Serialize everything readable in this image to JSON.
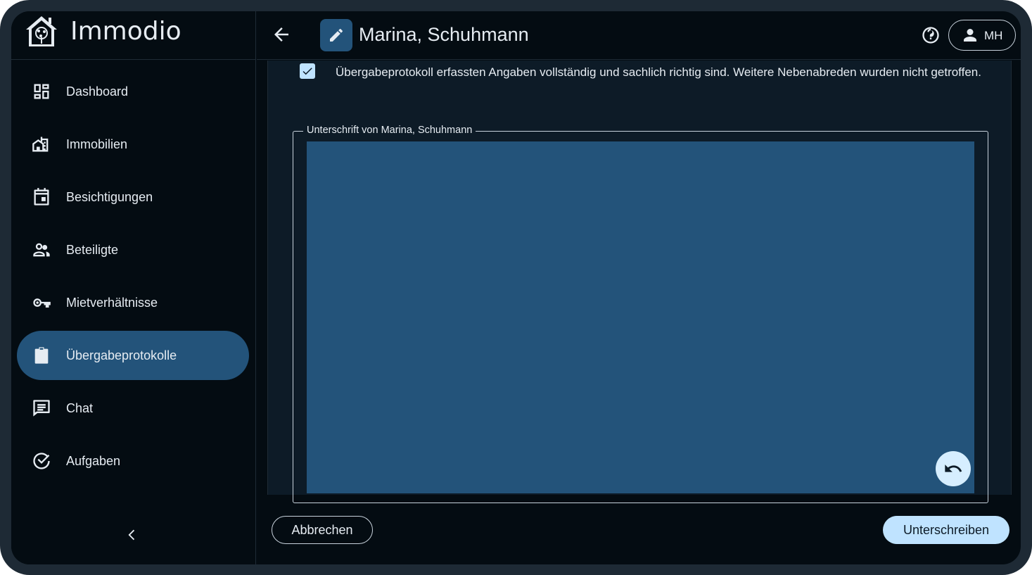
{
  "app": {
    "name": "Immodio",
    "logo_icon": "house-tree-icon"
  },
  "sidebar": {
    "items": [
      {
        "label": "Dashboard",
        "icon": "dashboard-icon",
        "active": false
      },
      {
        "label": "Immobilien",
        "icon": "buildings-icon",
        "active": false
      },
      {
        "label": "Besichtigungen",
        "icon": "calendar-icon",
        "active": false
      },
      {
        "label": "Beteiligte",
        "icon": "people-icon",
        "active": false
      },
      {
        "label": "Mietverhältnisse",
        "icon": "key-icon",
        "active": false
      },
      {
        "label": "Übergabeprotokolle",
        "icon": "clipboard-check-icon",
        "active": true
      },
      {
        "label": "Chat",
        "icon": "chat-icon",
        "active": false
      },
      {
        "label": "Aufgaben",
        "icon": "check-circle-icon",
        "active": false
      }
    ],
    "collapse_icon": "chevron-left-icon"
  },
  "header": {
    "title": "Marina, Schuhmann",
    "user_initials": "MH"
  },
  "content": {
    "consent_text": "Übergabeprotokoll erfassten Angaben vollständig und sachlich richtig sind. Weitere Nebenabreden wurden nicht getroffen.",
    "consent_checked": true,
    "signature_label": "Unterschrift von Marina, Schuhmann"
  },
  "footer": {
    "cancel_label": "Abbrechen",
    "sign_label": "Unterschreiben"
  },
  "colors": {
    "accent": "#23537a",
    "primary_button": "#bfe3ff",
    "background": "#040c12"
  }
}
